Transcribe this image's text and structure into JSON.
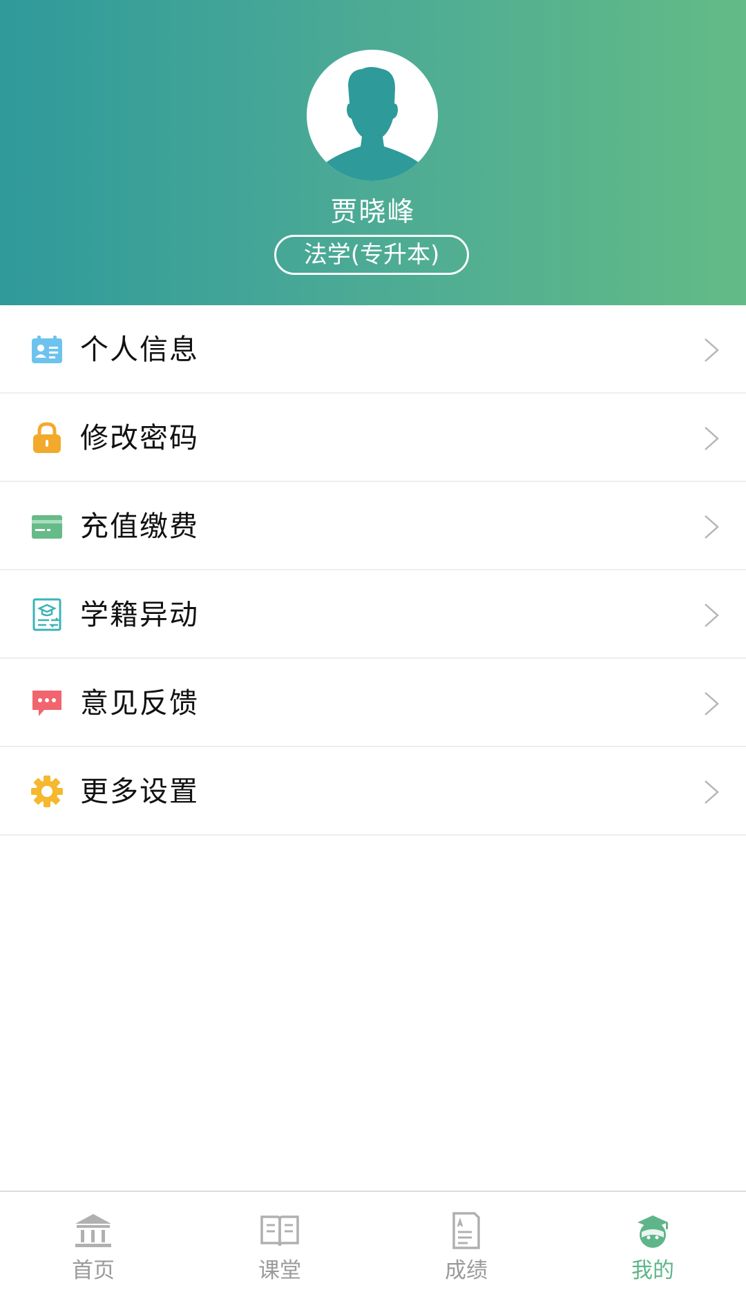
{
  "profile": {
    "name": "贾晓峰",
    "major": "法学(专升本)",
    "avatar_icon": "person-silhouette-icon"
  },
  "colors": {
    "header_gradient_start": "#2f9a9a",
    "header_gradient_end": "#63bb86",
    "active_tab": "#5fb58a",
    "inactive_tab": "#9a9a9a"
  },
  "menu": {
    "items": [
      {
        "label": "个人信息",
        "icon": "id-card-icon"
      },
      {
        "label": "修改密码",
        "icon": "lock-icon"
      },
      {
        "label": "充值缴费",
        "icon": "card-icon"
      },
      {
        "label": "学籍异动",
        "icon": "graduation-document-icon"
      },
      {
        "label": "意见反馈",
        "icon": "chat-bubble-icon"
      },
      {
        "label": "更多设置",
        "icon": "gear-icon"
      }
    ]
  },
  "tabbar": {
    "tabs": [
      {
        "label": "首页",
        "icon": "home-building-icon"
      },
      {
        "label": "课堂",
        "icon": "open-book-icon"
      },
      {
        "label": "成绩",
        "icon": "grade-document-icon"
      },
      {
        "label": "我的",
        "icon": "student-avatar-icon",
        "active": true
      }
    ]
  }
}
